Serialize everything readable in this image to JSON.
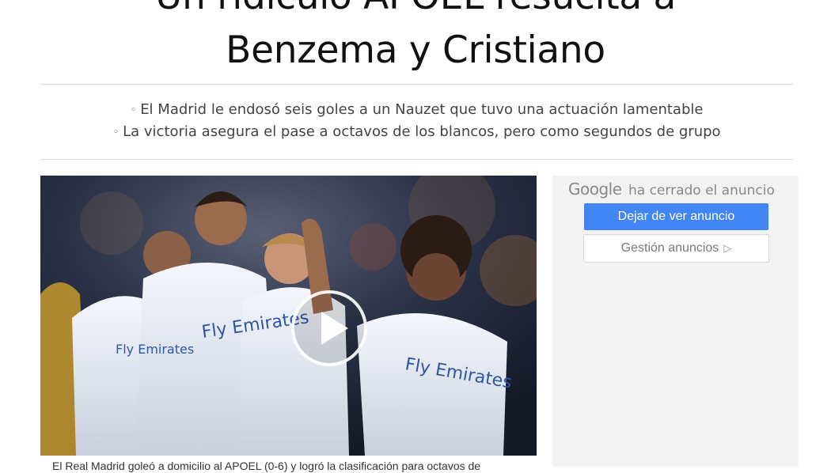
{
  "article": {
    "headline_line1": "Un ridículo APOEL resucita a",
    "headline_line2": "Benzema y Cristiano",
    "summary": [
      "El Madrid le endosó seis goles a un Nauzet que tuvo una actuación lamentable",
      "La victoria asegura el pase a octavos de los blancos, pero como segundos de grupo"
    ],
    "caption": "El Real Madrid goleó a domicilio al APOEL (0-6) y logró la clasificación para octavos de",
    "video": {
      "play_icon": "play-icon"
    },
    "photo_shirt_texts": [
      "Fly Emirates",
      "Fly Emirates",
      "Fly Emirates"
    ]
  },
  "ad_panel": {
    "google_logo": "Google",
    "closed_text": "ha cerrado el anuncio",
    "stop_button": "Dejar de ver anuncio",
    "manage_button": "Gestión anuncios",
    "adchoices_icon": "adchoices-icon"
  },
  "colors": {
    "accent_button": "#4285f4",
    "ad_background": "#f2f2f2",
    "rule": "#d9d9d9"
  }
}
